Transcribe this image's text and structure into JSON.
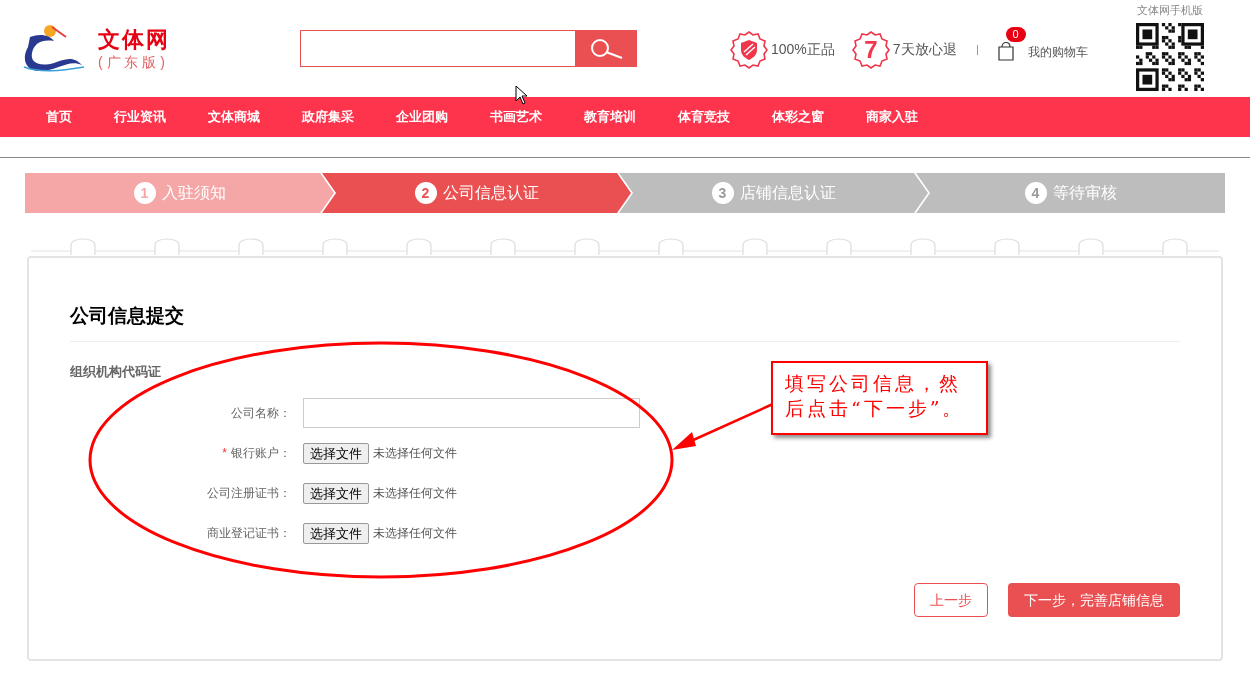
{
  "header": {
    "logo": {
      "name": "文体网",
      "edition": "( 广 东 版 )"
    },
    "guarantees": [
      {
        "kind": "shield",
        "label": "100%正品"
      },
      {
        "kind": "number",
        "badge": "7",
        "label": "7天放心退"
      }
    ],
    "cart": {
      "count": "0",
      "label": "我的购物车"
    },
    "mobile": {
      "label": "文体网手机版"
    }
  },
  "nav": [
    "首页",
    "行业资讯",
    "文体商城",
    "政府集采",
    "企业团购",
    "书画艺术",
    "教育培训",
    "体育竞技",
    "体彩之窗",
    "商家入驻"
  ],
  "steps": [
    {
      "number": "1",
      "label": "入驻须知",
      "completed": true,
      "selected": false
    },
    {
      "number": "2",
      "label": "公司信息认证",
      "completed": false,
      "selected": true
    },
    {
      "number": "3",
      "label": "店铺信息认证",
      "completed": false,
      "selected": false
    },
    {
      "number": "4",
      "label": "等待审核",
      "completed": false,
      "selected": false
    }
  ],
  "form": {
    "title": "公司信息提交",
    "section": "组织机构代码证",
    "fields": [
      {
        "kind": "text",
        "label": "公司名称："
      },
      {
        "kind": "file",
        "required_mark": "*",
        "label": "银行账户：",
        "button": "选择文件",
        "status": "未选择任何文件"
      },
      {
        "kind": "file",
        "label": "公司注册证书：",
        "button": "选择文件",
        "status": "未选择任何文件"
      },
      {
        "kind": "file",
        "label": "商业登记证书：",
        "button": "选择文件",
        "status": "未选择任何文件"
      }
    ]
  },
  "buttons": [
    {
      "kind": "secondary",
      "label": "上一步"
    },
    {
      "kind": "primary",
      "label": "下一步，完善店铺信息"
    }
  ],
  "annotation": {
    "text": "填写公司信息，然后点击“下一步”。"
  }
}
